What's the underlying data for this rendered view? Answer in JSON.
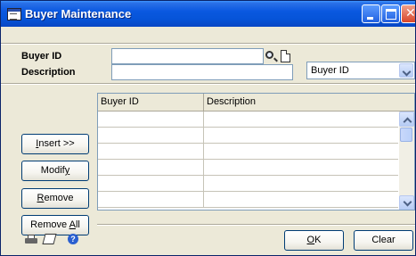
{
  "window": {
    "title": "Buyer Maintenance"
  },
  "form": {
    "buyer_id_label": "Buyer ID",
    "buyer_id_value": "",
    "description_label": "Description",
    "description_value": "",
    "sort_select": {
      "selected": "Buyer ID"
    }
  },
  "grid": {
    "columns": [
      "Buyer ID",
      "Description"
    ],
    "rows": [
      [
        "",
        ""
      ],
      [
        "",
        ""
      ],
      [
        "",
        ""
      ],
      [
        "",
        ""
      ],
      [
        "",
        ""
      ],
      [
        "",
        ""
      ]
    ]
  },
  "buttons": {
    "insert_pre": "",
    "insert_mn": "I",
    "insert_post": "nsert >>",
    "modify_pre": "Modif",
    "modify_mn": "y",
    "modify_post": "",
    "remove_pre": "",
    "remove_mn": "R",
    "remove_post": "emove",
    "remove_all_pre": "Remove ",
    "remove_all_mn": "A",
    "remove_all_post": "ll",
    "ok_pre": "",
    "ok_mn": "O",
    "ok_post": "K",
    "clear_pre": "Clear",
    "clear_mn": "",
    "clear_post": ""
  },
  "footer_icons": [
    "printer-icon",
    "note-icon",
    "help-icon"
  ],
  "help_glyph": "?",
  "colors": {
    "titlebar": "#0a58e0",
    "window_bg": "#ece9d8",
    "field_border": "#7f9db9"
  }
}
